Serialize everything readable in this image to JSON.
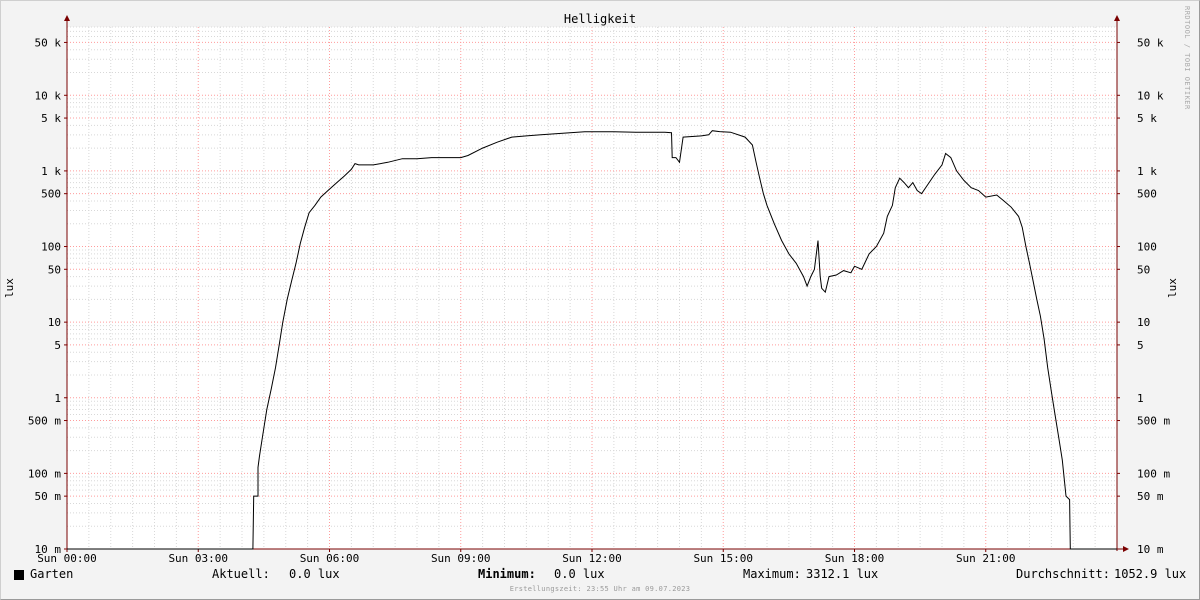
{
  "chart_data": {
    "type": "line",
    "title": "Helligkeit",
    "ylabel": "lux",
    "yscale": "log",
    "ylim": [
      0.01,
      80000
    ],
    "xlim": [
      "Sun 00:00",
      "Sun 24:00"
    ],
    "x_tick_labels": [
      "Sun 00:00",
      "Sun 03:00",
      "Sun 06:00",
      "Sun 09:00",
      "Sun 12:00",
      "Sun 15:00",
      "Sun 18:00",
      "Sun 21:00"
    ],
    "y_tick_labels": [
      "50 k",
      "10 k",
      "5 k",
      "1 k",
      "500",
      "100",
      "50",
      "10",
      "5",
      "1",
      "500 m",
      "100 m",
      "50 m",
      "10 m"
    ],
    "grid": true,
    "series": [
      {
        "name": "Garten",
        "color": "#000000",
        "points": [
          [
            "Sun 00:00",
            0
          ],
          [
            "Sun 04:15",
            0
          ],
          [
            "Sun 04:16",
            0.05
          ],
          [
            "Sun 04:22",
            0.05
          ],
          [
            "Sun 04:22",
            0.12
          ],
          [
            "Sun 04:24",
            0.17
          ],
          [
            "Sun 04:28",
            0.3
          ],
          [
            "Sun 04:34",
            0.7
          ],
          [
            "Sun 04:40",
            1.3
          ],
          [
            "Sun 04:46",
            2.5
          ],
          [
            "Sun 04:51",
            5
          ],
          [
            "Sun 04:56",
            10
          ],
          [
            "Sun 05:02",
            20
          ],
          [
            "Sun 05:08",
            35
          ],
          [
            "Sun 05:14",
            60
          ],
          [
            "Sun 05:20",
            110
          ],
          [
            "Sun 05:26",
            180
          ],
          [
            "Sun 05:32",
            280
          ],
          [
            "Sun 05:40",
            350
          ],
          [
            "Sun 05:48",
            450
          ],
          [
            "Sun 05:58",
            550
          ],
          [
            "Sun 06:10",
            700
          ],
          [
            "Sun 06:20",
            850
          ],
          [
            "Sun 06:30",
            1050
          ],
          [
            "Sun 06:35",
            1250
          ],
          [
            "Sun 06:40",
            1200
          ],
          [
            "Sun 07:00",
            1200
          ],
          [
            "Sun 07:20",
            1300
          ],
          [
            "Sun 07:40",
            1450
          ],
          [
            "Sun 08:00",
            1450
          ],
          [
            "Sun 08:20",
            1500
          ],
          [
            "Sun 08:40",
            1500
          ],
          [
            "Sun 09:00",
            1500
          ],
          [
            "Sun 09:10",
            1600
          ],
          [
            "Sun 09:30",
            2000
          ],
          [
            "Sun 09:50",
            2400
          ],
          [
            "Sun 10:10",
            2800
          ],
          [
            "Sun 10:30",
            2900
          ],
          [
            "Sun 10:50",
            3000
          ],
          [
            "Sun 11:10",
            3100
          ],
          [
            "Sun 11:30",
            3200
          ],
          [
            "Sun 11:50",
            3300
          ],
          [
            "Sun 12:30",
            3300
          ],
          [
            "Sun 13:00",
            3250
          ],
          [
            "Sun 13:40",
            3250
          ],
          [
            "Sun 13:49",
            3200
          ],
          [
            "Sun 13:50",
            1500
          ],
          [
            "Sun 13:55",
            1500
          ],
          [
            "Sun 14:00",
            1300
          ],
          [
            "Sun 14:05",
            2800
          ],
          [
            "Sun 14:30",
            2900
          ],
          [
            "Sun 14:40",
            3000
          ],
          [
            "Sun 14:45",
            3400
          ],
          [
            "Sun 14:55",
            3312.1
          ],
          [
            "Sun 15:10",
            3250
          ],
          [
            "Sun 15:30",
            2800
          ],
          [
            "Sun 15:40",
            2200
          ],
          [
            "Sun 15:45",
            1300
          ],
          [
            "Sun 15:50",
            800
          ],
          [
            "Sun 15:55",
            500
          ],
          [
            "Sun 16:00",
            350
          ],
          [
            "Sun 16:10",
            200
          ],
          [
            "Sun 16:20",
            120
          ],
          [
            "Sun 16:30",
            80
          ],
          [
            "Sun 16:40",
            60
          ],
          [
            "Sun 16:50",
            40
          ],
          [
            "Sun 16:55",
            30
          ],
          [
            "Sun 17:00",
            40
          ],
          [
            "Sun 17:05",
            50
          ],
          [
            "Sun 17:10",
            120
          ],
          [
            "Sun 17:13",
            40
          ],
          [
            "Sun 17:15",
            28
          ],
          [
            "Sun 17:20",
            25
          ],
          [
            "Sun 17:25",
            40
          ],
          [
            "Sun 17:35",
            42
          ],
          [
            "Sun 17:45",
            48
          ],
          [
            "Sun 17:55",
            45
          ],
          [
            "Sun 18:00",
            55
          ],
          [
            "Sun 18:10",
            50
          ],
          [
            "Sun 18:20",
            80
          ],
          [
            "Sun 18:30",
            100
          ],
          [
            "Sun 18:40",
            150
          ],
          [
            "Sun 18:45",
            250
          ],
          [
            "Sun 18:52",
            350
          ],
          [
            "Sun 18:56",
            600
          ],
          [
            "Sun 19:02",
            800
          ],
          [
            "Sun 19:08",
            700
          ],
          [
            "Sun 19:14",
            600
          ],
          [
            "Sun 19:20",
            700
          ],
          [
            "Sun 19:26",
            550
          ],
          [
            "Sun 19:32",
            500
          ],
          [
            "Sun 19:40",
            650
          ],
          [
            "Sun 19:50",
            900
          ],
          [
            "Sun 20:00",
            1200
          ],
          [
            "Sun 20:05",
            1700
          ],
          [
            "Sun 20:12",
            1500
          ],
          [
            "Sun 20:20",
            1000
          ],
          [
            "Sun 20:30",
            750
          ],
          [
            "Sun 20:40",
            600
          ],
          [
            "Sun 20:50",
            550
          ],
          [
            "Sun 21:00",
            450
          ],
          [
            "Sun 21:15",
            480
          ],
          [
            "Sun 21:25",
            400
          ],
          [
            "Sun 21:35",
            330
          ],
          [
            "Sun 21:45",
            250
          ],
          [
            "Sun 21:50",
            180
          ],
          [
            "Sun 21:55",
            100
          ],
          [
            "Sun 22:00",
            60
          ],
          [
            "Sun 22:05",
            35
          ],
          [
            "Sun 22:10",
            20
          ],
          [
            "Sun 22:15",
            12
          ],
          [
            "Sun 22:20",
            6
          ],
          [
            "Sun 22:25",
            2.5
          ],
          [
            "Sun 22:30",
            1.2
          ],
          [
            "Sun 22:35",
            0.6
          ],
          [
            "Sun 22:40",
            0.3
          ],
          [
            "Sun 22:45",
            0.15
          ],
          [
            "Sun 22:50",
            0.05
          ],
          [
            "Sun 22:55",
            0.045
          ],
          [
            "Sun 22:56",
            0
          ],
          [
            "Sun 24:00",
            0
          ]
        ]
      }
    ]
  },
  "colors": {
    "background": "#f3f3f3",
    "plot_background": "#ffffff",
    "major_grid": "#ff9c9c",
    "minor_grid": "#d8d8d8",
    "axis": "#7a0000",
    "line": "#000000"
  },
  "legend": {
    "swatch_color": "#000000",
    "series_name": "Garten",
    "current_label": "Aktuell:",
    "current_value": "0.0 lux",
    "min_label": "Minimum:",
    "min_value": "0.0 lux",
    "max_label": "Maximum:",
    "max_value": "3312.1 lux",
    "avg_label": "Durchschnitt:",
    "avg_value": "1052.9 lux"
  },
  "footer": "Erstellungszeit: 23:55 Uhr am 09.07.2023",
  "watermark": "RRDTOOL / TOBI OETIKER"
}
